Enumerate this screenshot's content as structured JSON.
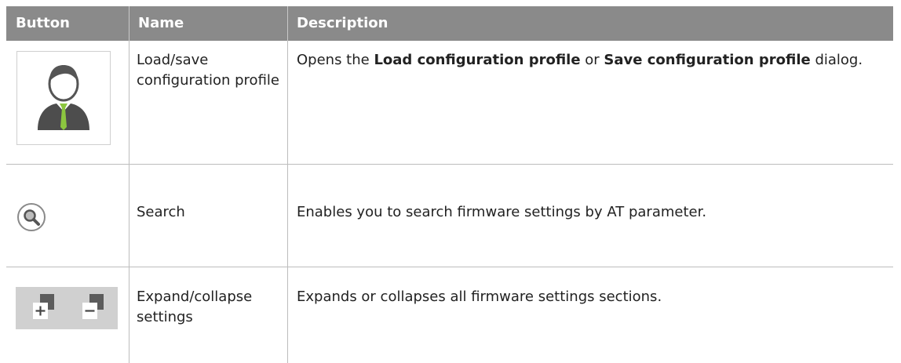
{
  "header": {
    "col_button": "Button",
    "col_name": "Name",
    "col_description": "Description"
  },
  "rows": [
    {
      "icon": "user-profile-icon",
      "name": "Load/save configuration profile",
      "description": {
        "prefix": "Opens the ",
        "bold1": "Load configuration profile",
        "middle": " or ",
        "bold2": "Save configuration profile",
        "suffix": " dialog."
      }
    },
    {
      "icon": "search-icon",
      "name": "Search",
      "description": {
        "text": "Enables you to search firmware settings by AT parameter."
      }
    },
    {
      "icon": "expand-collapse-icon",
      "name": "Expand/collapse settings",
      "description": {
        "text": "Expands or collapses all firmware settings sections."
      }
    }
  ],
  "colors": {
    "header_bg": "#8a8a8a",
    "tie_green": "#8cc63f",
    "figure_gray": "#4d4d4d"
  }
}
